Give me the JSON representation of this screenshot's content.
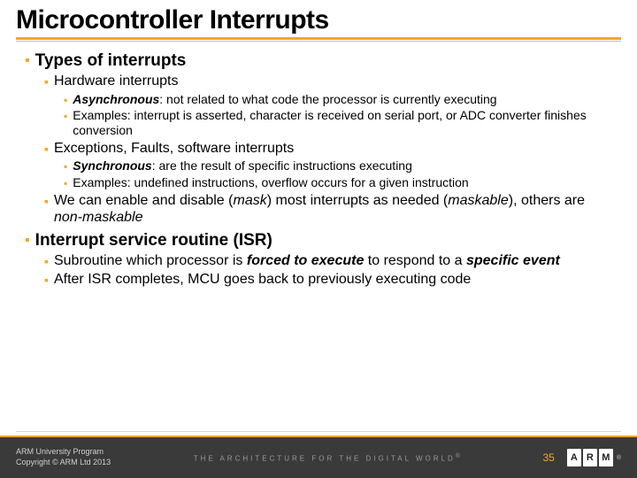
{
  "title": "Microcontroller Interrupts",
  "s1": {
    "heading": "Types of interrupts",
    "a": {
      "heading": "Hardware interrupts",
      "p1_term": "Asynchronous",
      "p1_rest": ": not related to what code the processor is currently executing",
      "p2": "Examples: interrupt is asserted, character is received on serial port, or ADC converter finishes conversion"
    },
    "b": {
      "heading": "Exceptions, Faults, software interrupts",
      "p1_term": "Synchronous",
      "p1_rest": ": are the result of specific instructions executing",
      "p2": "Examples: undefined instructions, overflow occurs for a given instruction"
    },
    "c": {
      "pre": "We can enable and disable (",
      "mask": "mask",
      "mid": ") most interrupts as needed (",
      "maskable": "maskable",
      "mid2": "), others are ",
      "nonmask": "non-maskable"
    }
  },
  "s2": {
    "heading": "Interrupt service routine (ISR)",
    "a": {
      "pre": "Subroutine which processor is ",
      "forced": "forced to execute",
      "mid": " to respond to a ",
      "event": "specific event"
    },
    "b": "After ISR completes, MCU goes back to previously executing code"
  },
  "footer": {
    "line1": "ARM University Program",
    "line2": "Copyright © ARM Ltd 2013",
    "tagline": "THE ARCHITECTURE FOR THE DIGITAL WORLD",
    "page": "35",
    "logo": "ARM"
  }
}
